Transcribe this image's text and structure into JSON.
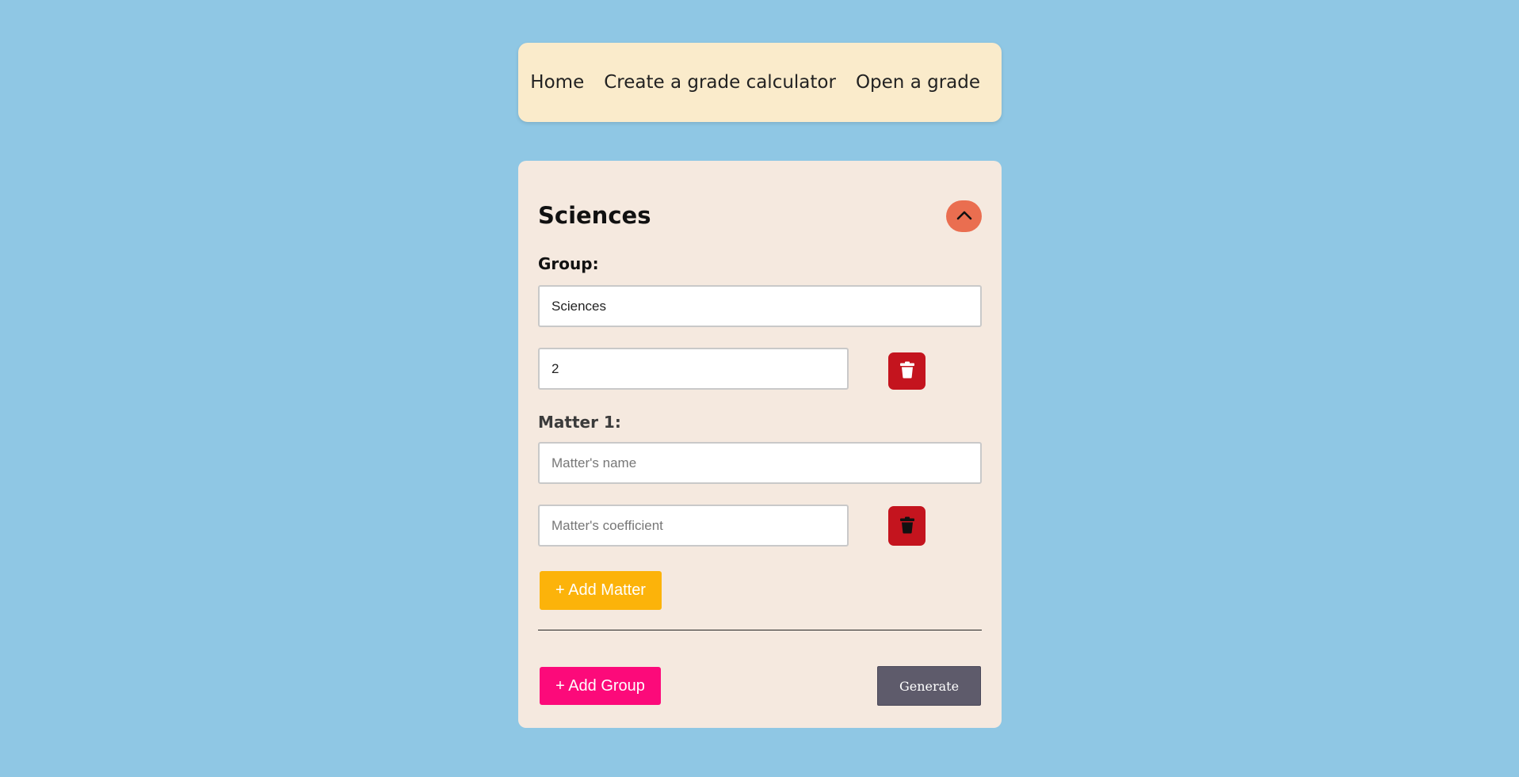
{
  "nav": {
    "links": [
      "Home",
      "Create a grade calculator",
      "Open a grade"
    ]
  },
  "group": {
    "title": "Sciences",
    "collapse_icon": "chevron-up-icon",
    "group_label": "Group:",
    "name_value": "Sciences",
    "coefficient_value": "2",
    "delete_icon": "trash-icon"
  },
  "matters": [
    {
      "label": "Matter 1:",
      "name_placeholder": "Matter's name",
      "coefficient_placeholder": "Matter's coefficient",
      "delete_icon": "trash-icon"
    }
  ],
  "actions": {
    "add_matter": "+ Add Matter",
    "add_group": "+ Add Group",
    "generate": "Generate"
  },
  "colors": {
    "background": "#8fc7e4",
    "nav_bg": "#faebcb",
    "card_bg": "#f5e9df",
    "collapse": "#ea6e50",
    "delete": "#c4141e",
    "add_matter": "#fcb30a",
    "add_group": "#fc0a7a",
    "generate": "#5e5b6b"
  }
}
